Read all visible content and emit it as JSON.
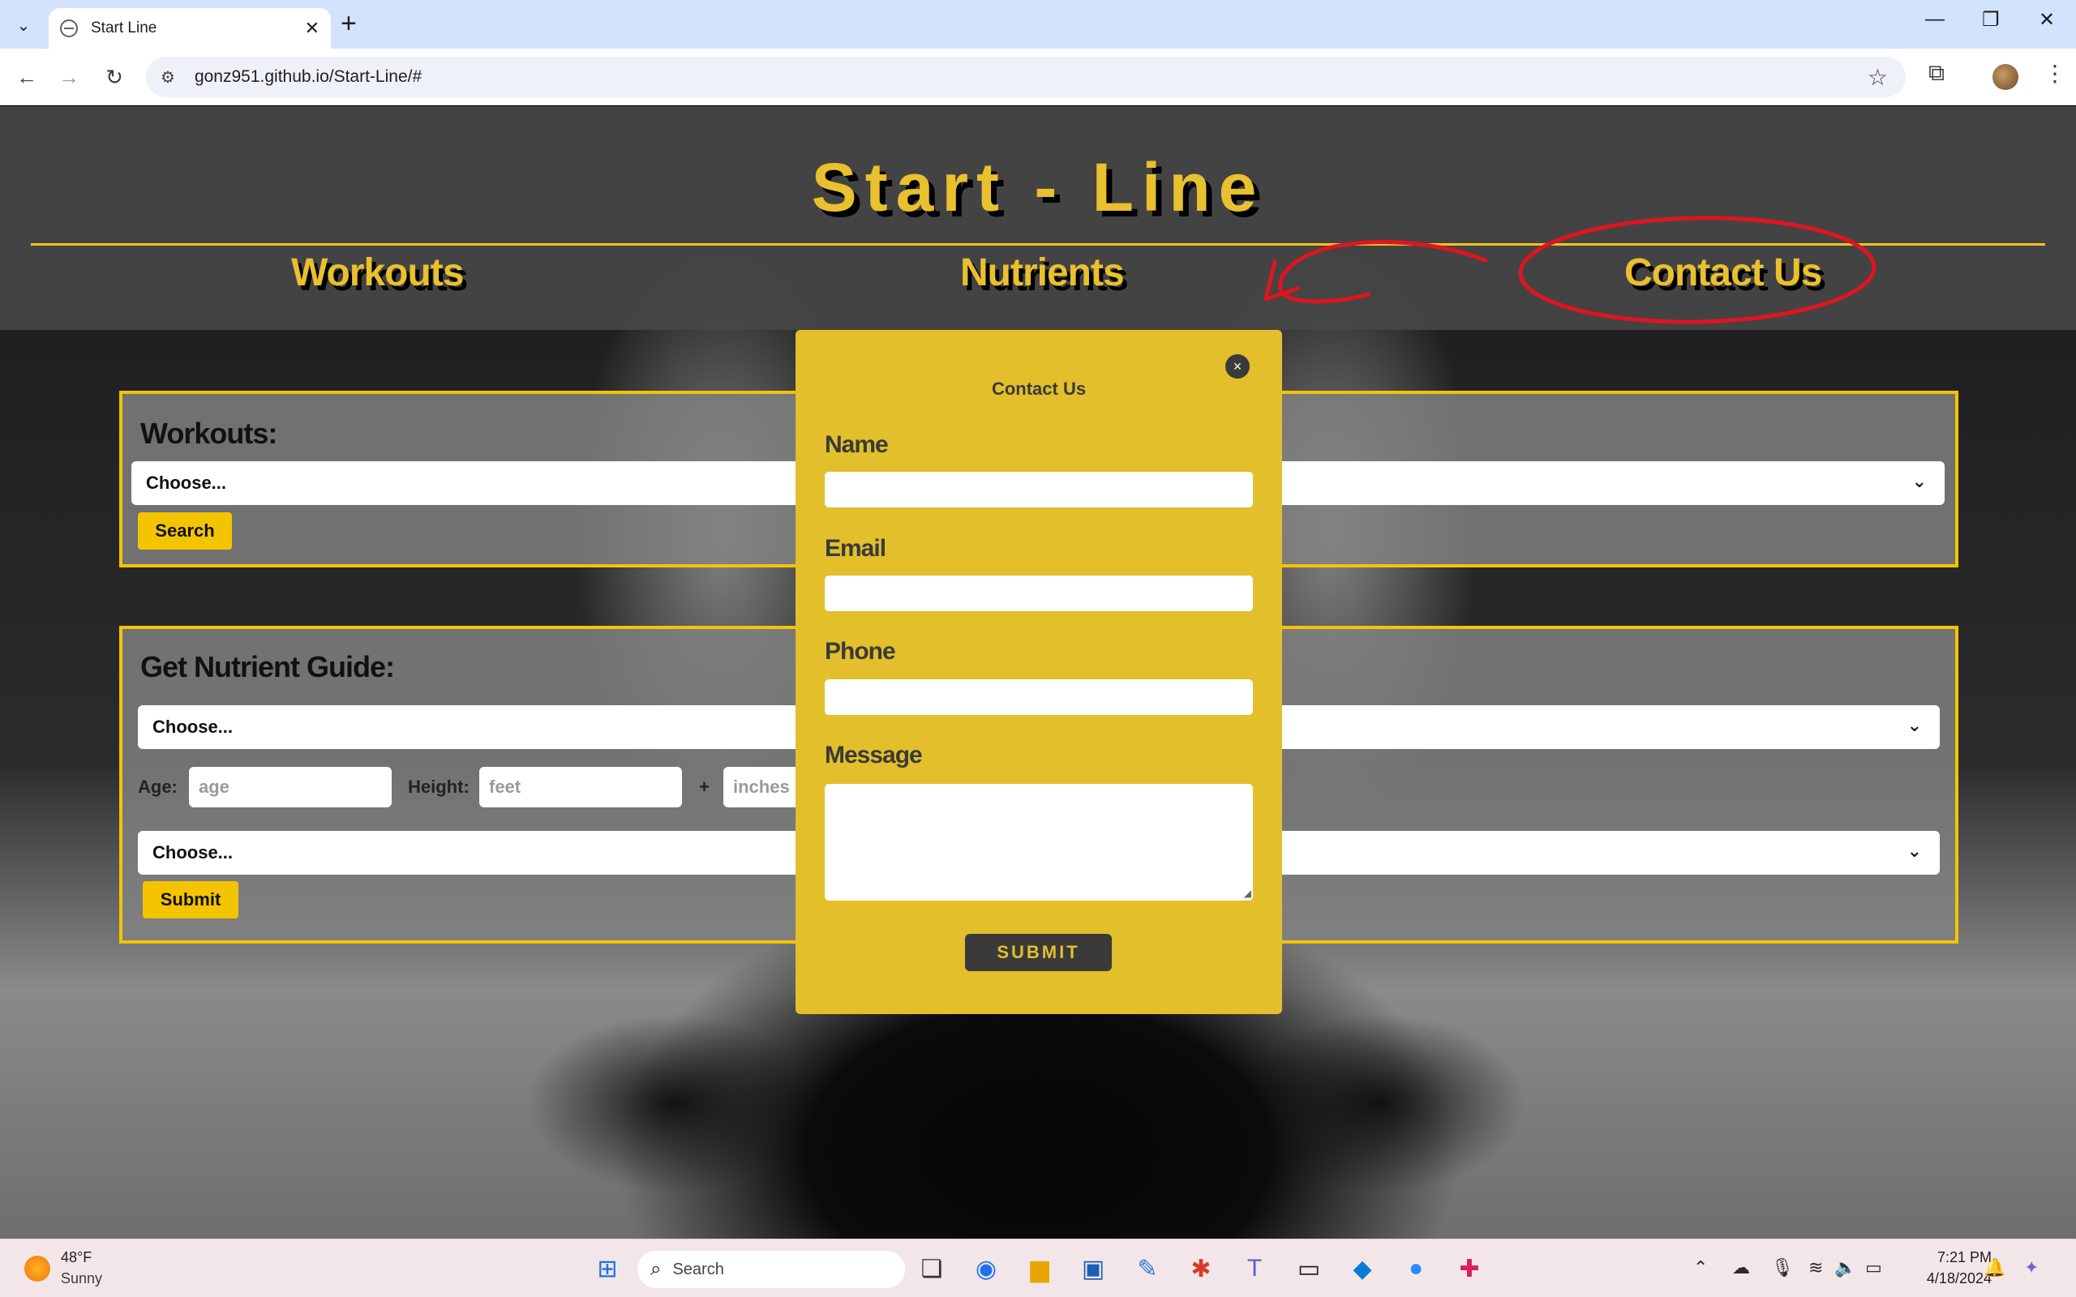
{
  "browser": {
    "tab_title": "Start Line",
    "url": "gonz951.github.io/Start-Line/#"
  },
  "site": {
    "title": "Start - Line",
    "nav": [
      "Workouts",
      "Nutrients",
      "Contact Us"
    ]
  },
  "workouts": {
    "heading": "Workouts:",
    "select_value": "Choose...",
    "search_label": "Search"
  },
  "nutrients": {
    "heading": "Get Nutrient Guide:",
    "select1_value": "Choose...",
    "age_label": "Age:",
    "age_placeholder": "age",
    "height_label": "Height:",
    "feet_placeholder": "feet",
    "plus": "+",
    "inches_placeholder": "inches",
    "select2_value": "Choose...",
    "submit_label": "Submit"
  },
  "modal": {
    "title": "Contact Us",
    "close": "×",
    "name_label": "Name",
    "email_label": "Email",
    "phone_label": "Phone",
    "message_label": "Message",
    "submit_label": "SUBMIT"
  },
  "annotation_color": "#e0141e",
  "accent_color": "#f4c400",
  "taskbar": {
    "temp": "48°F",
    "condition": "Sunny",
    "search_label": "Search",
    "time": "7:21 PM",
    "date": "4/18/2024"
  }
}
